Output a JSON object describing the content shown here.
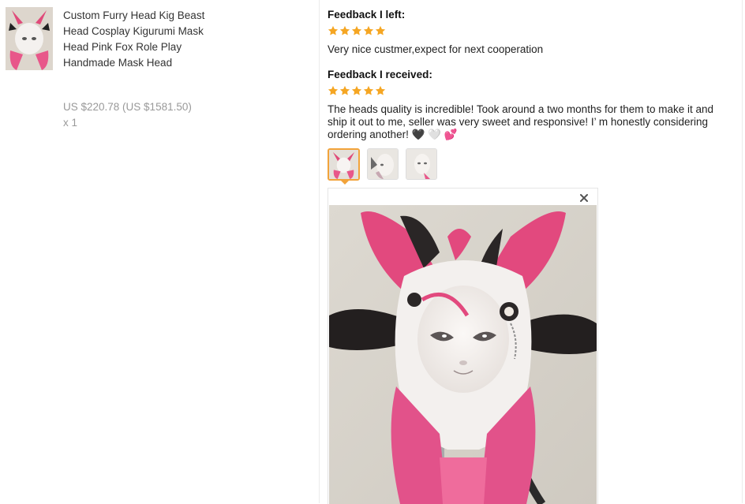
{
  "product": {
    "title": "Custom Furry Head Kig Beast Head Cosplay Kigurumi Mask Head Pink Fox Role Play Handmade Mask Head",
    "price": "US $220.78 (US $1581.50)",
    "quantity": "x 1"
  },
  "feedback_left": {
    "heading": "Feedback I left:",
    "rating": 5,
    "text": "Very nice custmer,expect for next cooperation"
  },
  "feedback_received": {
    "heading": "Feedback I received:",
    "rating": 5,
    "text": "The heads quality is incredible! Took around a two months for them to make it and ship it out to me, seller was very sweet and responsive! I’ m honestly considering ordering another! 🖤 🤍 💕"
  },
  "photo_viewer": {
    "thumbnail_count": 3,
    "active_thumbnail": 1,
    "close_label": "×"
  },
  "colors": {
    "star": "#f5a623",
    "active_border": "#f2a33a",
    "muted_text": "#999999"
  }
}
